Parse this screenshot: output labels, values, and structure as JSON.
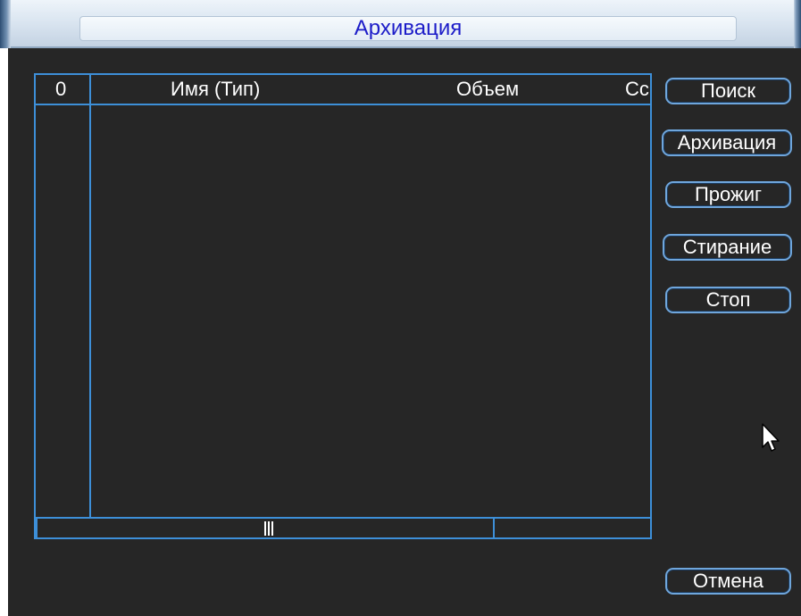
{
  "window": {
    "title": "Архивация"
  },
  "table": {
    "columns": [
      "0",
      "Имя (Тип)",
      "Объем",
      "Сс"
    ],
    "rows": []
  },
  "buttons": {
    "search": "Поиск",
    "backup": "Архивация",
    "burn": "Прожиг",
    "erase": "Стирание",
    "stop": "Стоп",
    "cancel": "Отмена"
  },
  "icons": {
    "cursor": "mouse-pointer-icon",
    "scroll_grip": "scroll-grip-icon"
  },
  "colors": {
    "accent": "#3d8fd8",
    "title_text": "#1c1cc8",
    "background": "#262626"
  }
}
